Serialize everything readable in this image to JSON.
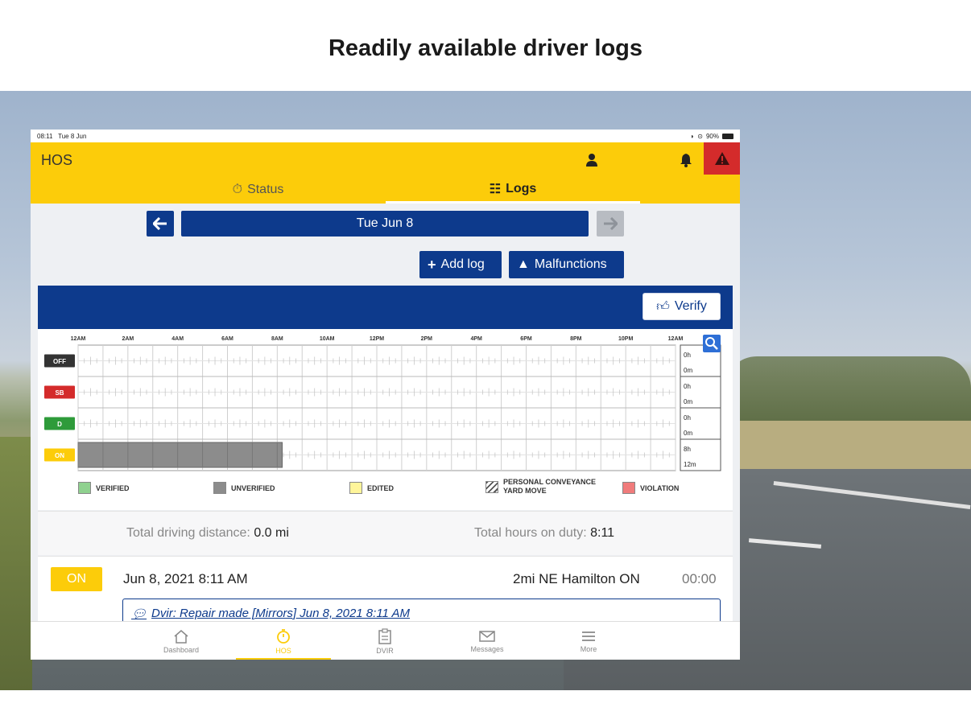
{
  "headline": "Readily available driver logs",
  "status_bar": {
    "time": "08:11",
    "date": "Tue 8 Jun",
    "battery": "90%"
  },
  "app": {
    "title": "HOS",
    "tabs": [
      {
        "label": "Status",
        "icon": "stopwatch-icon"
      },
      {
        "label": "Logs",
        "icon": "list-icon",
        "active": true
      }
    ]
  },
  "date_nav": {
    "current_date": "Tue Jun 8"
  },
  "actions": {
    "add_log": "Add log",
    "malfunctions": "Malfunctions",
    "verify": "Verify"
  },
  "chart_data": {
    "type": "table",
    "title": "",
    "time_labels": [
      "12AM",
      "2AM",
      "4AM",
      "6AM",
      "8AM",
      "10AM",
      "12PM",
      "2PM",
      "4PM",
      "6PM",
      "8PM",
      "10PM",
      "12AM"
    ],
    "rows": [
      {
        "status": "OFF",
        "color": "#333333",
        "total_h": "0h",
        "total_m": "0m"
      },
      {
        "status": "SB",
        "color": "#d42b2b",
        "total_h": "0h",
        "total_m": "0m"
      },
      {
        "status": "D",
        "color": "#2e9b3a",
        "total_h": "0h",
        "total_m": "0m"
      },
      {
        "status": "ON",
        "color": "#fccc0a",
        "total_h": "8h",
        "total_m": "12m"
      }
    ],
    "segments": [
      {
        "status": "ON",
        "start_hour": 0,
        "end_hour": 8.2,
        "kind": "UNVERIFIED"
      }
    ]
  },
  "legend": [
    {
      "label": "VERIFIED",
      "color": "#8fd18f"
    },
    {
      "label": "UNVERIFIED",
      "color": "#8c8c8c"
    },
    {
      "label": "EDITED",
      "color": "#fff59a"
    },
    {
      "label_line1": "PERSONAL CONVEYANCE",
      "label_line2": "YARD MOVE",
      "pattern": "hatched"
    },
    {
      "label": "VIOLATION",
      "color": "#f07b7b"
    }
  ],
  "totals": {
    "distance_label": "Total driving distance:",
    "distance_value": "0.0 mi",
    "hours_label": "Total hours on duty:",
    "hours_value": "8:11"
  },
  "event": {
    "status": "ON",
    "datetime": "Jun 8, 2021 8:11 AM",
    "location": "2mi NE Hamilton ON",
    "duration": "00:00",
    "note": "Dvir: Repair made [Mirrors] Jun 8, 2021 8:11 AM"
  },
  "bottom_nav": [
    {
      "label": "Dashboard",
      "icon": "home-icon"
    },
    {
      "label": "HOS",
      "icon": "stopwatch-icon",
      "active": true
    },
    {
      "label": "DVIR",
      "icon": "clipboard-icon"
    },
    {
      "label": "Messages",
      "icon": "envelope-icon"
    },
    {
      "label": "More",
      "icon": "menu-icon"
    }
  ]
}
